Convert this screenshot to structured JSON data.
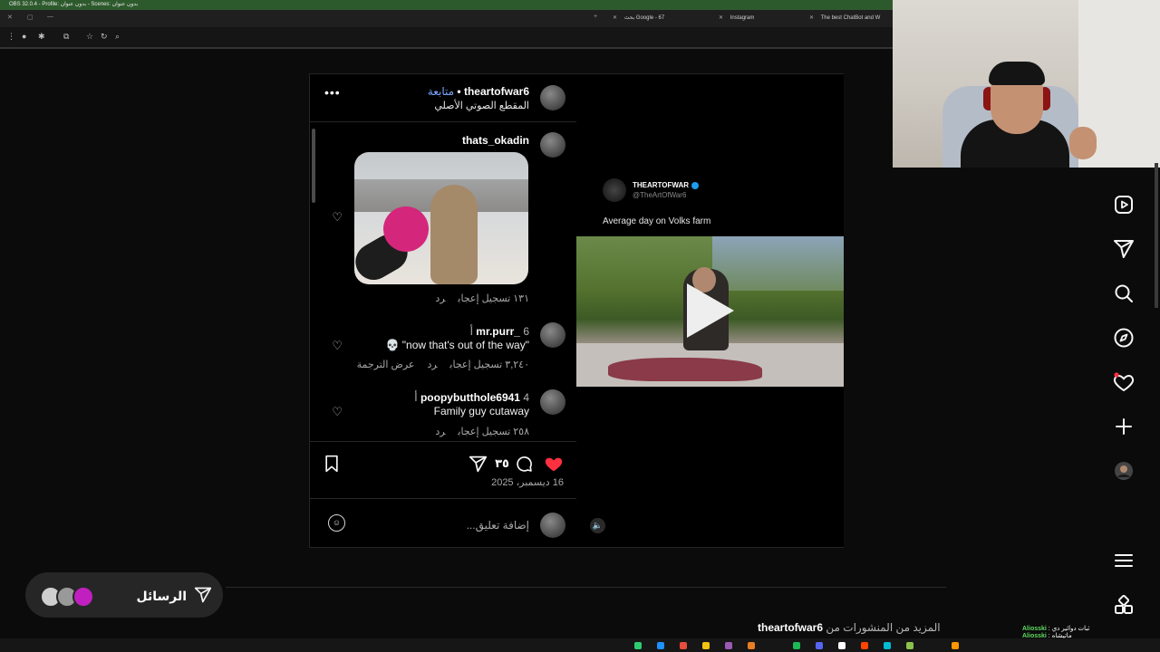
{
  "window": {
    "title": "OBS 32.0.4 - Profile: بدون عنوان - Scenes: بدون عنوان"
  },
  "browser": {
    "tabs": [
      {
        "label": "بحث Google - 67"
      },
      {
        "label": "Instagram"
      },
      {
        "label": "The best ChatBot and W"
      }
    ]
  },
  "post": {
    "author": "theartofwar6",
    "follow_label": "متابعة",
    "audio_label": "المقطع الصوتي الأصلي",
    "media": {
      "tweet_name": "THEARTOFWAR",
      "tweet_handle": "@TheArtOfWar6",
      "tweet_text": "Average day on Volks farm"
    },
    "comments": [
      {
        "username": "thats_okadin",
        "time": "",
        "text": "",
        "likes": "١٣١ تسجيل إعجاب",
        "reply": "رد",
        "translate": ""
      },
      {
        "username": "mr.purr_",
        "time": "6 أ",
        "text": "\"now that's out of the way\" 💀",
        "likes": "٣,٢٤٠ تسجيل إعجاب",
        "reply": "رد",
        "translate": "عرض الترجمة"
      },
      {
        "username": "poopybutthole6941",
        "time": "4 أ",
        "text": "Family guy cutaway",
        "likes": "٢٥٨ تسجيل إعجاب",
        "reply": "رد",
        "translate": ""
      }
    ],
    "comment_count": "٣٥",
    "date": "16 ديسمبر، 2025",
    "add_comment_placeholder": "إضافة تعليق...",
    "colors": {
      "like_red": "#ff3040",
      "follow_blue": "#7aa7ff"
    }
  },
  "messages": {
    "label": "الرسائل"
  },
  "more_from": {
    "prefix": "المزيد من المنشورات من",
    "user": "theartofwar6"
  },
  "chat_overlay": [
    {
      "user": "Aliosski",
      "text": "ثبات دوائير دي"
    },
    {
      "user": "Aliosski",
      "text": "ماتيشاه"
    }
  ]
}
